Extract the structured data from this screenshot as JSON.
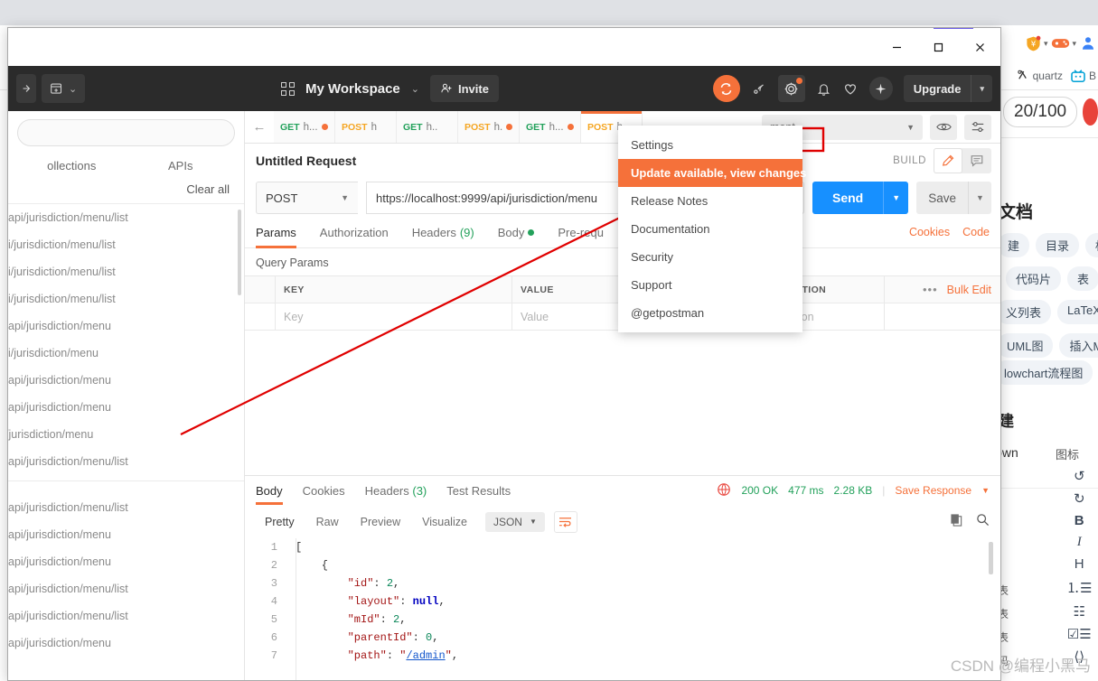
{
  "browser": {
    "extensions": [
      "shield-yen-icon",
      "gamepad-icon",
      "person-blue-icon"
    ],
    "bookmarks": [
      {
        "icon": "quartz-icon",
        "label": "quartz"
      },
      {
        "icon": "bilibili-icon",
        "label": "B"
      }
    ],
    "csdn": {
      "word_count": "20/100",
      "heading": "文档",
      "chips_row1": [
        "建",
        "目录",
        "标"
      ],
      "chips_row2": [
        "代码片",
        "表"
      ],
      "chips_row3": [
        "义列表",
        "LaTeX"
      ],
      "chips_row4": [
        "UML图",
        "插入M"
      ],
      "chips_row5": [
        "lowchart流程图"
      ],
      "heading2": "建",
      "markdown_label": "lown",
      "icon_label": "图标",
      "toolbar_icons": [
        "undo-icon",
        "redo-icon",
        "bold-icon",
        "italic-icon",
        "heading-icon",
        "ordered-list-icon",
        "unordered-list-icon",
        "task-list-icon",
        "code-icon"
      ],
      "side_labels": [
        "表",
        "表",
        "表",
        "码"
      ]
    }
  },
  "window": {
    "controls": {
      "minimize": "minimize-icon",
      "maximize": "maximize-icon",
      "close": "close-icon"
    }
  },
  "header": {
    "new_button": "new-icon",
    "workspace_name": "My Workspace",
    "invite_label": "Invite",
    "sync_icon": "sync-icon",
    "antenna_icon": "antenna-icon",
    "settings_icon": "gear-icon",
    "bell_icon": "bell-icon",
    "heart_icon": "heart-icon",
    "plus_icon": "plus-icon",
    "upgrade_label": "Upgrade"
  },
  "sidebar": {
    "search_placeholder": "",
    "tabs": [
      "ollections",
      "APIs"
    ],
    "clear_all": "Clear all",
    "history_group1": [
      "api/jurisdiction/menu/list",
      "pi/jurisdiction/menu/list",
      "pi/jurisdiction/menu/list",
      "pi/jurisdiction/menu/list",
      "api/jurisdiction/menu",
      "pi/jurisdiction/menu",
      "api/jurisdiction/menu",
      "api/jurisdiction/menu",
      "/jurisdiction/menu",
      "api/jurisdiction/menu/list"
    ],
    "history_group2": [
      "api/jurisdiction/menu/list",
      "api/jurisdiction/menu",
      "api/jurisdiction/menu",
      "api/jurisdiction/menu/list",
      "api/jurisdiction/menu/list",
      "api/jurisdiction/menu"
    ]
  },
  "tabstrip": {
    "tabs": [
      {
        "method": "GET",
        "name": "h...",
        "dirty": true,
        "active": false
      },
      {
        "method": "POST",
        "name": "h",
        "dirty": false,
        "active": false
      },
      {
        "method": "GET",
        "name": "h..",
        "dirty": false,
        "active": false
      },
      {
        "method": "POST",
        "name": "h.",
        "dirty": true,
        "active": false
      },
      {
        "method": "GET",
        "name": "h...",
        "dirty": true,
        "active": false
      },
      {
        "method": "POST",
        "name": "h.",
        "dirty": true,
        "active": true
      }
    ],
    "environment": "ment",
    "eye_icon": "eye-icon",
    "settings_icon": "sliders-icon"
  },
  "request": {
    "title": "Untitled Request",
    "build_label": "BUILD",
    "edit_icon": "pencil-icon",
    "comment_icon": "comment-icon",
    "method": "POST",
    "url": "https://localhost:9999/api/jurisdiction/menu",
    "send_label": "Send",
    "save_label": "Save",
    "tabs": [
      {
        "label": "Params",
        "count": "",
        "active": true
      },
      {
        "label": "Authorization",
        "count": "",
        "active": false
      },
      {
        "label": "Headers",
        "count": "(9)",
        "active": false
      },
      {
        "label": "Body",
        "count": "",
        "active": false
      },
      {
        "label": "Pre-requ",
        "count": "",
        "active": false
      }
    ],
    "cookies_link": "Cookies",
    "code_link": "Code",
    "query_params_label": "Query Params",
    "table": {
      "headers": [
        "KEY",
        "VALUE",
        "DESCRIPTION"
      ],
      "bulk_edit": "Bulk Edit",
      "row_placeholders": [
        "Key",
        "Value",
        "Description"
      ]
    }
  },
  "response": {
    "tabs": [
      {
        "label": "Body",
        "count": "",
        "active": true
      },
      {
        "label": "Cookies",
        "count": "",
        "active": false
      },
      {
        "label": "Headers",
        "count": "(3)",
        "active": false
      },
      {
        "label": "Test Results",
        "count": "",
        "active": false
      }
    ],
    "globe_icon": "globe-icon",
    "status": "200 OK",
    "time": "477 ms",
    "size": "2.28 KB",
    "save_response": "Save Response",
    "view_modes": [
      "Pretty",
      "Raw",
      "Preview",
      "Visualize"
    ],
    "format": "JSON",
    "wrap_icon": "wrap-lines-icon",
    "copy_icon": "copy-icon",
    "search_icon": "search-icon",
    "body_lines": [
      {
        "no": "1",
        "html": "["
      },
      {
        "no": "2",
        "html": "    {"
      },
      {
        "no": "3",
        "html": "        <span class='k'>\"id\"</span>: <span class='n'>2</span>,"
      },
      {
        "no": "4",
        "html": "        <span class='k'>\"layout\"</span>: <span class='nul'>null</span>,"
      },
      {
        "no": "5",
        "html": "        <span class='k'>\"mId\"</span>: <span class='n'>2</span>,"
      },
      {
        "no": "6",
        "html": "        <span class='k'>\"parentId\"</span>: <span class='n'>0</span>,"
      },
      {
        "no": "7",
        "html": "        <span class='k'>\"path\"</span>: <span class='s'>\"<span class='lnk'>/admin</span>\"</span>,"
      }
    ]
  },
  "dropdown": {
    "items": [
      {
        "label": "Settings",
        "highlight": false
      },
      {
        "label": "Update available, view changes",
        "highlight": true
      },
      {
        "label": "Release Notes",
        "highlight": false
      },
      {
        "label": "Documentation",
        "highlight": false
      },
      {
        "label": "Security",
        "highlight": false
      },
      {
        "label": "Support",
        "highlight": false
      },
      {
        "label": "@getpostman",
        "highlight": false
      }
    ]
  },
  "annotation": {
    "watermark": "CSDN @编程小黑马",
    "arrow_color": "#e00000",
    "box_color": "#e00000"
  },
  "colors": {
    "accent_orange": "#f5713a",
    "send_blue": "#1790ff",
    "get_green": "#23a15b",
    "post_yellow": "#f5a623",
    "header_dark": "#2b2b2b"
  }
}
